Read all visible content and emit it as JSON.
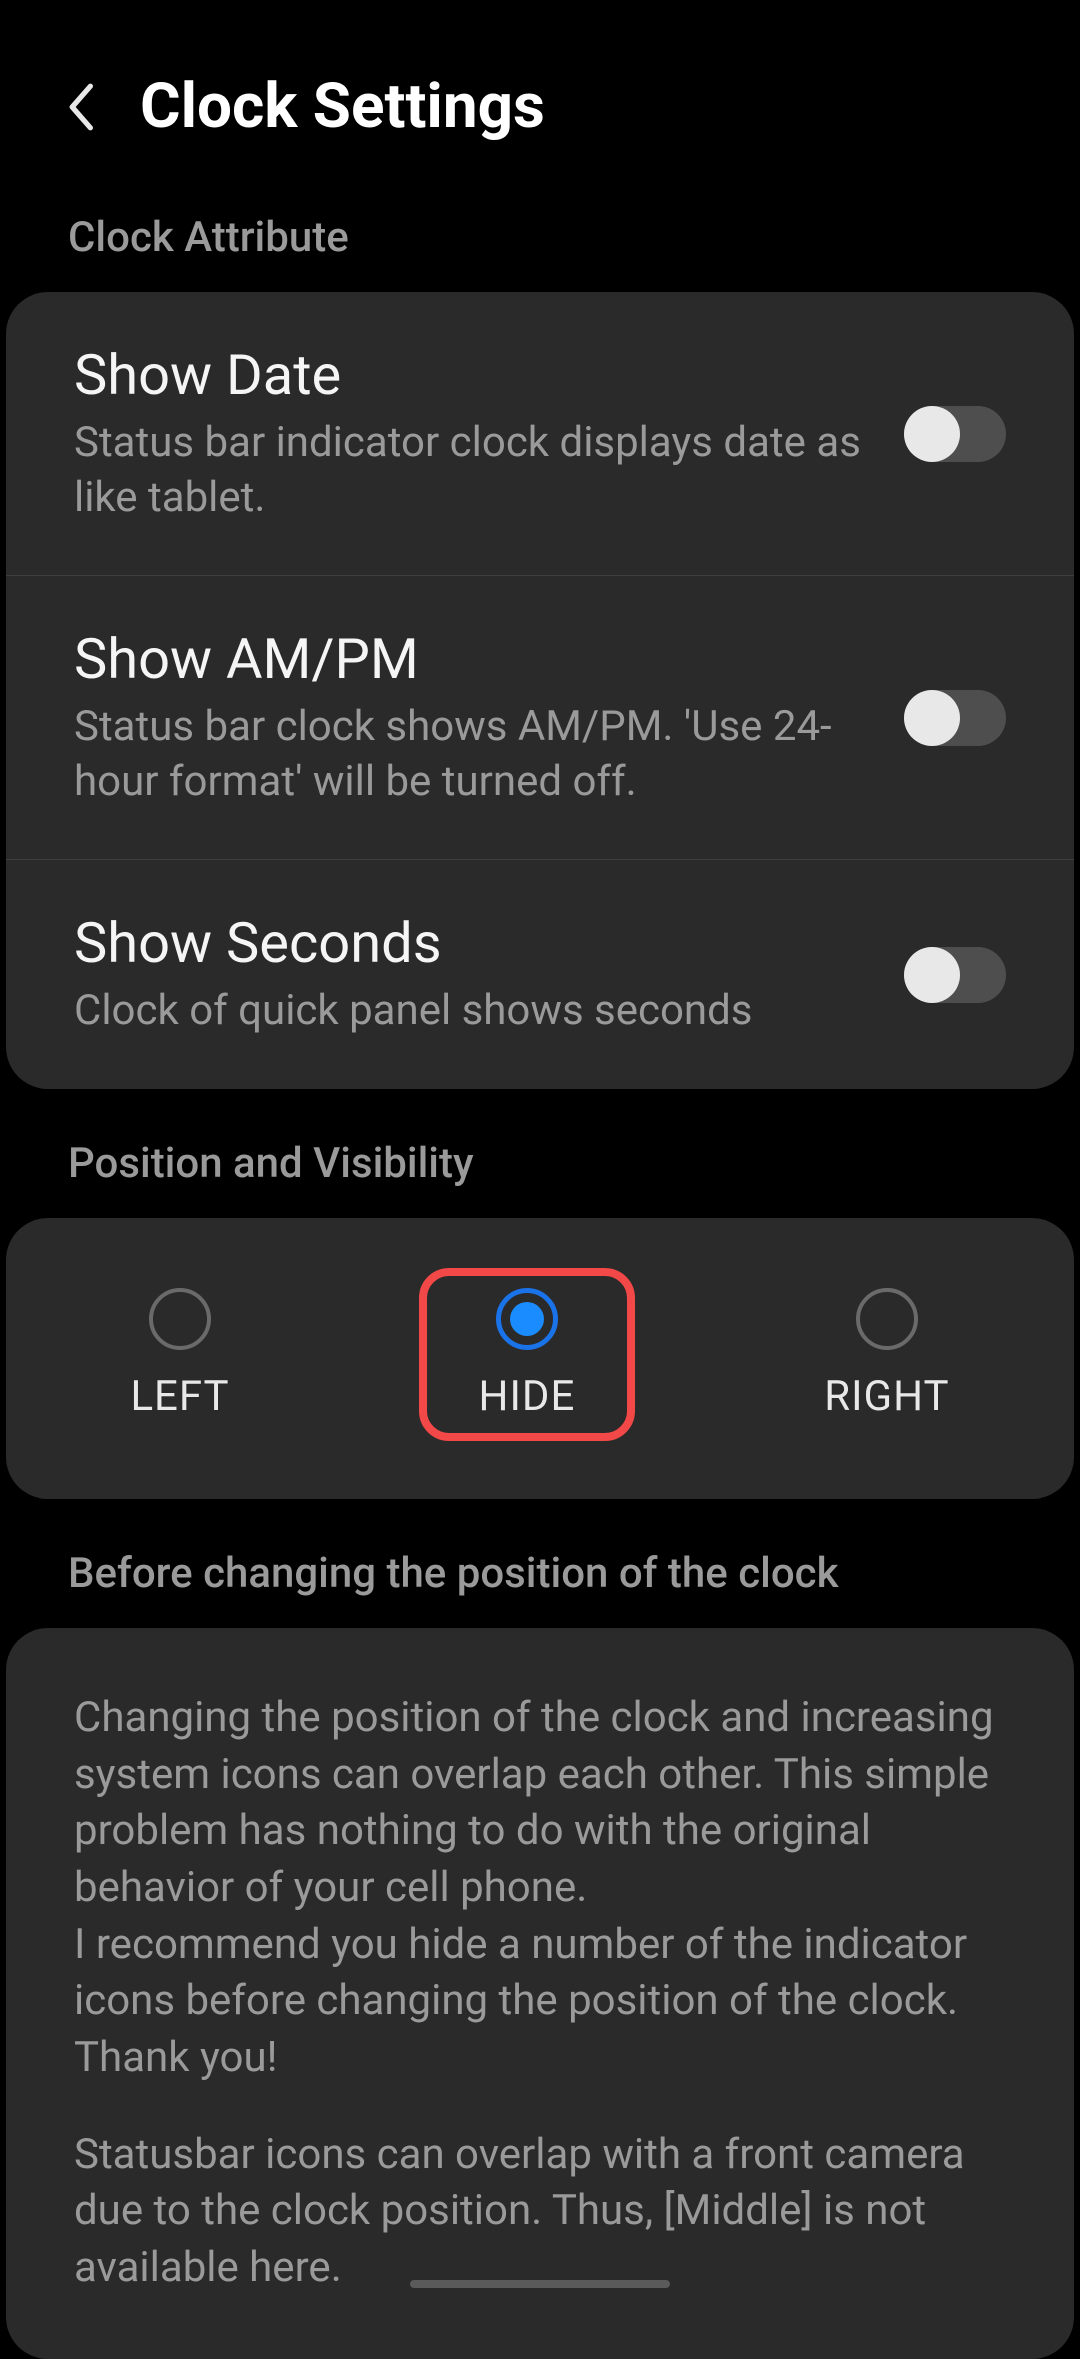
{
  "header": {
    "title": "Clock Settings"
  },
  "sections": {
    "attribute_label": "Clock Attribute",
    "position_label": "Position and Visibility",
    "before_label": "Before changing the position of the clock"
  },
  "settings": {
    "show_date": {
      "title": "Show Date",
      "desc": "Status bar indicator clock displays date as like tablet.",
      "enabled": false
    },
    "show_ampm": {
      "title": "Show AM/PM",
      "desc": "Status bar clock shows AM/PM. 'Use 24-hour format' will be turned off.",
      "enabled": false
    },
    "show_seconds": {
      "title": "Show Seconds",
      "desc": "Clock of quick panel shows seconds",
      "enabled": false
    }
  },
  "position": {
    "options": {
      "left": "LEFT",
      "hide": "HIDE",
      "right": "RIGHT"
    },
    "selected": "hide"
  },
  "info": {
    "text1": "Changing the position of the clock and increasing system icons can overlap each other. This simple problem has nothing to do with the original behavior of your cell phone.\n I recommend you hide a number of the indicator icons before changing the position of the clock.\n Thank you!",
    "text2": "Statusbar icons can overlap with a front camera due to the clock position. Thus, [Middle] is not available here."
  }
}
